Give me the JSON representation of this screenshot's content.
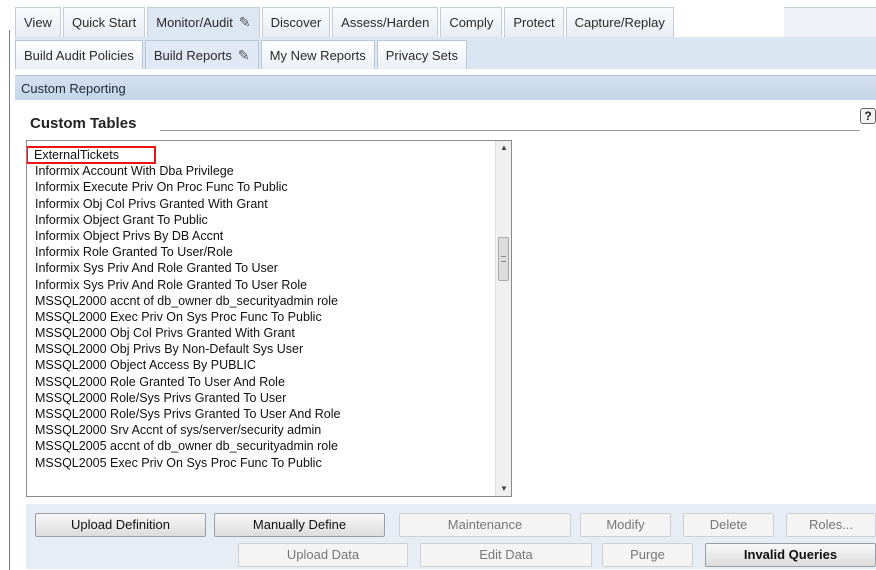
{
  "top_tabs": [
    {
      "label": "View"
    },
    {
      "label": "Quick Start"
    },
    {
      "label": "Monitor/Audit",
      "edit_icon": "pencil-icon"
    },
    {
      "label": "Discover"
    },
    {
      "label": "Assess/Harden"
    },
    {
      "label": "Comply"
    },
    {
      "label": "Protect"
    },
    {
      "label": "Capture/Replay"
    }
  ],
  "sub_tabs": [
    {
      "label": "Build Audit Policies"
    },
    {
      "label": "Build Reports",
      "edit_icon": "pencil-icon"
    },
    {
      "label": "My New Reports"
    },
    {
      "label": "Privacy Sets"
    }
  ],
  "section": {
    "title": "Custom Reporting"
  },
  "panel": {
    "title": "Custom Tables",
    "help": "?"
  },
  "tables": [
    "ExternalTickets",
    "Informix Account With Dba Privilege",
    "Informix Execute Priv On Proc Func To Public",
    "Informix Obj Col Privs Granted With Grant",
    "Informix Object Grant To Public",
    "Informix Object Privs By DB Accnt",
    "Informix Role Granted To User/Role",
    "Informix Sys Priv And Role Granted To User",
    "Informix Sys Priv And Role Granted To User Role",
    "MSSQL2000 accnt of db_owner db_securityadmin role",
    "MSSQL2000 Exec Priv On Sys Proc Func To Public",
    "MSSQL2000 Obj Col Privs Granted With Grant",
    "MSSQL2000 Obj Privs By Non-Default Sys User",
    "MSSQL2000 Object Access By PUBLIC",
    "MSSQL2000 Role Granted To User And Role",
    "MSSQL2000 Role/Sys Privs Granted To User",
    "MSSQL2000 Role/Sys Privs Granted To User And Role",
    "MSSQL2000 Srv Accnt of sys/server/security admin",
    "MSSQL2005 accnt of db_owner db_securityadmin role",
    "MSSQL2005 Exec Priv On Sys Proc Func To Public"
  ],
  "buttons": {
    "upload_definition": "Upload Definition",
    "manually_define": "Manually Define",
    "maintenance": "Maintenance",
    "modify": "Modify",
    "delete": "Delete",
    "roles": "Roles...",
    "upload_data": "Upload Data",
    "edit_data": "Edit Data",
    "purge": "Purge",
    "invalid_queries": "Invalid Queries"
  },
  "colors": {
    "highlight_border": "#e11111",
    "section_bar": "#c9d9ec"
  }
}
